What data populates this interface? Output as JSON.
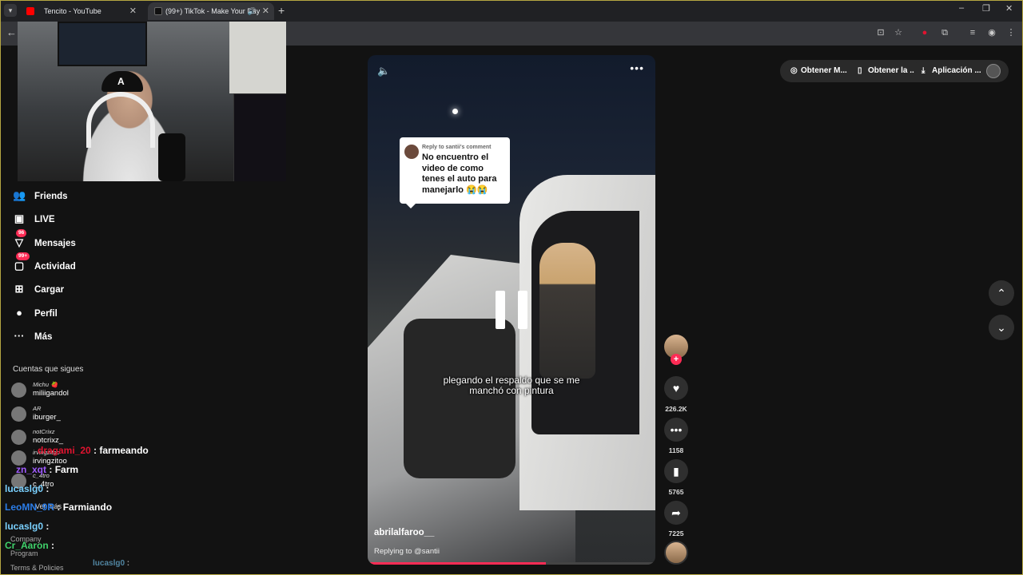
{
  "browser": {
    "tabs": [
      {
        "title": "Tencito - YouTube",
        "active": false
      },
      {
        "title": "(99+) TikTok - Make Your Day",
        "active": true
      }
    ],
    "window_controls": [
      "–",
      "❐",
      "✕"
    ]
  },
  "sidebar": {
    "nav": [
      {
        "label": "Friends",
        "icon": "friends-icon",
        "badge": ""
      },
      {
        "label": "LIVE",
        "icon": "live-icon",
        "badge": ""
      },
      {
        "label": "Mensajes",
        "icon": "messages-icon",
        "badge": "96"
      },
      {
        "label": "Actividad",
        "icon": "activity-icon",
        "badge": "99+"
      },
      {
        "label": "Cargar",
        "icon": "upload-icon",
        "badge": ""
      },
      {
        "label": "Perfil",
        "icon": "profile-icon",
        "badge": ""
      },
      {
        "label": "Más",
        "icon": "more-icon",
        "badge": ""
      }
    ],
    "following_title": "Cuentas que sigues",
    "following": [
      {
        "name": "Michu 🍓",
        "username": "miliigandol"
      },
      {
        "name": "AR",
        "username": "iburger_"
      },
      {
        "name": "notCrixz",
        "username": "notcrixz_"
      },
      {
        "name": "irvingzitoo",
        "username": "irvingzitoo"
      },
      {
        "name": "c_4tro",
        "username": "c_4tro"
      }
    ],
    "see_more": "Ver más",
    "footer": [
      "Company",
      "Program",
      "Terms & Policies"
    ]
  },
  "chat_overlay": [
    {
      "user": "dragami_20",
      "message": "farmeando",
      "color": "#e0132f"
    },
    {
      "user": "zn_xqt",
      "message": "Farm",
      "color": "#a05bff"
    },
    {
      "user": "lucaslg0",
      "message": "",
      "color": "#7ad1ff"
    },
    {
      "user": "LeoMN_9R",
      "message": "Farmiando",
      "color": "#2b7de9"
    },
    {
      "user": "lucaslg0",
      "message": "",
      "color": "#7ad1ff"
    },
    {
      "user": "Cr_Aaron",
      "message": "",
      "color": "#3fd06a"
    },
    {
      "user": "lucaslg0",
      "message": "",
      "color": "#7ad1ff"
    }
  ],
  "video": {
    "reply_header": "Reply to santii's comment",
    "reply_body": "No encuentro el video de como tenes el auto para manejarlo 😭😭",
    "caption": "plegando el respaldo que se me manchó con pintura",
    "author": "abrilalfaroo__",
    "replying_to": "Replying to @santii",
    "progress_fraction": 0.62
  },
  "actions": {
    "likes": "226.2K",
    "comments": "1158",
    "saves": "5765",
    "shares": "7225"
  },
  "top_right": {
    "pills": [
      "Obtener M...",
      "Obtener la ...",
      "Aplicación ..."
    ]
  }
}
